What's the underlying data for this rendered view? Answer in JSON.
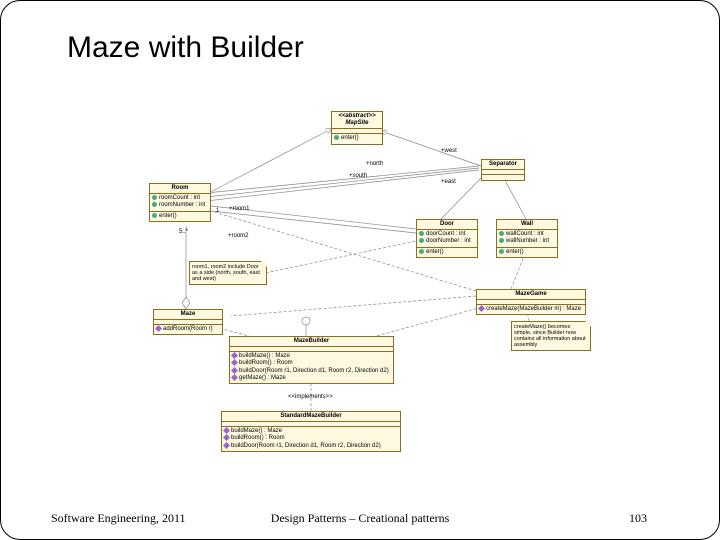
{
  "slide": {
    "title": "Maze with Builder"
  },
  "classes": {
    "mapsite": {
      "stereotype": "<<abstract>>",
      "name": "MapSite",
      "ops": [
        "enter()"
      ]
    },
    "room": {
      "name": "Room",
      "attrs": [
        "roomCount : int",
        "roomNumber : int"
      ],
      "ops": [
        "enter()"
      ]
    },
    "separator": {
      "name": "Separator"
    },
    "door": {
      "name": "Door",
      "attrs": [
        "doorCount : int",
        "doorNumber : int"
      ],
      "ops": [
        "enter()"
      ]
    },
    "wall": {
      "name": "Wall",
      "attrs": [
        "wallCount : int",
        "wallNumber : int"
      ],
      "ops": [
        "enter()"
      ]
    },
    "maze": {
      "name": "Maze",
      "ops": [
        "addRoom(Room r)"
      ]
    },
    "mazegame": {
      "name": "MazeGame",
      "ops": [
        "createMaze(MazeBuilder m) : Maze"
      ]
    },
    "mazebuilder": {
      "name": "MazeBuilder",
      "ops": [
        "buildMaze() : Maze",
        "buildRoom() : Room",
        "buildDoor(Room r1, Direction d1, Room r2, Direction d2)",
        "getMaze() : Maze"
      ]
    },
    "standard": {
      "name": "StandardMazeBuilder",
      "ops": [
        "buildMaze() : Maze",
        "buildRoom() : Room",
        "buildDoor(Room r1, Direction d1, Room r2, Direction d2)"
      ]
    }
  },
  "notes": {
    "roomnote": "room1, room2 include Door as a side (north, south, east and west)",
    "createnote": "createMaze() becomes simple, since Builder now contains all information about assembly"
  },
  "labels": {
    "north": "+north",
    "south": "+south",
    "east": "+east",
    "west": "+west",
    "room1": "+room1",
    "room2": "+room2",
    "one": "1",
    "five": "5..*",
    "implements": "<<implements>>"
  },
  "footer": {
    "left": "Software Engineering, 2011",
    "center": "Design Patterns – Creational patterns",
    "right": "103"
  }
}
